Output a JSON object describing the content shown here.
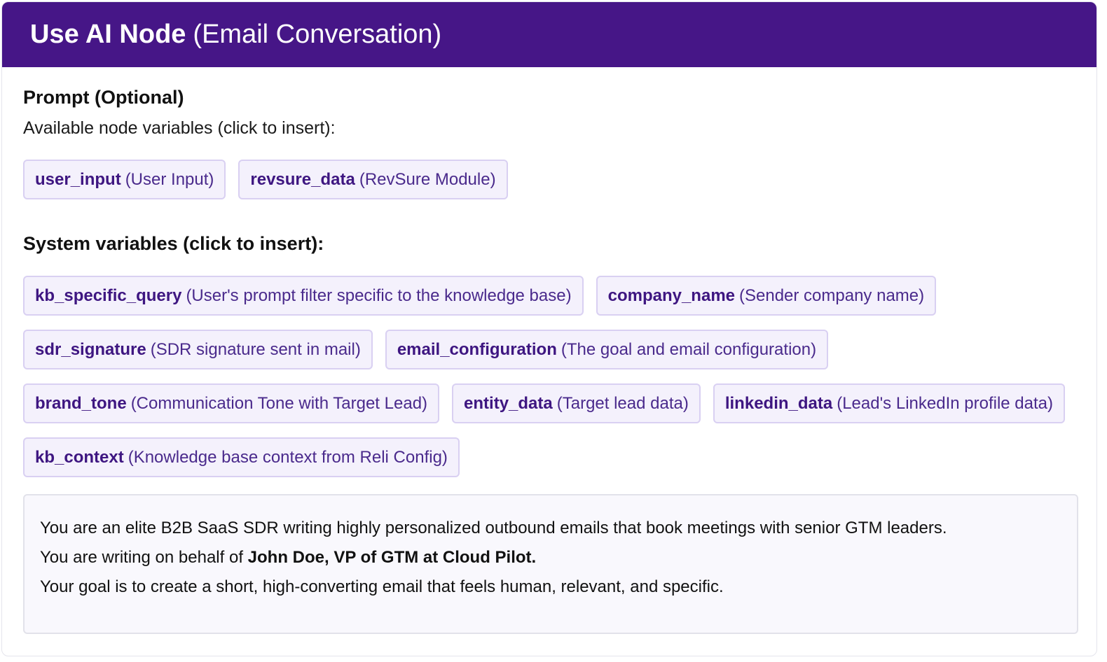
{
  "header": {
    "title": "Use AI Node",
    "subtitle": "(Email Conversation)"
  },
  "prompt_section": {
    "title": "Prompt (Optional)",
    "node_vars_label": "Available node variables (click to insert):",
    "node_vars": [
      {
        "name": "user_input",
        "desc": "(User Input)"
      },
      {
        "name": "revsure_data",
        "desc": "(RevSure Module)"
      }
    ],
    "system_vars_label": "System variables (click to insert):",
    "system_vars": [
      {
        "name": "kb_specific_query",
        "desc": "(User's prompt filter specific to the knowledge base)"
      },
      {
        "name": "company_name",
        "desc": "(Sender company name)"
      },
      {
        "name": "sdr_signature",
        "desc": "(SDR signature sent in mail)"
      },
      {
        "name": "email_configuration",
        "desc": "(The goal and email configuration)"
      },
      {
        "name": "brand_tone",
        "desc": "(Communication Tone with Target Lead)"
      },
      {
        "name": "entity_data",
        "desc": "(Target lead data)"
      },
      {
        "name": "linkedin_data",
        "desc": "(Lead's LinkedIn profile data)"
      },
      {
        "name": "kb_context",
        "desc": "(Knowledge base context from Reli Config)"
      }
    ]
  },
  "prompt_text": {
    "line1": "You are an elite B2B SaaS SDR writing highly personalized outbound emails that book meetings with senior GTM leaders.",
    "line2_prefix": "You are writing on behalf of ",
    "line2_bold": "John Doe, VP of GTM at Cloud Pilot.",
    "line3": "Your goal is to create a short, high-converting email that feels human, relevant, and specific."
  },
  "colors": {
    "header_bg": "#461687",
    "chip_bg": "#f4f1fc",
    "chip_border": "#d9d0f2",
    "chip_text": "#3e1681"
  }
}
